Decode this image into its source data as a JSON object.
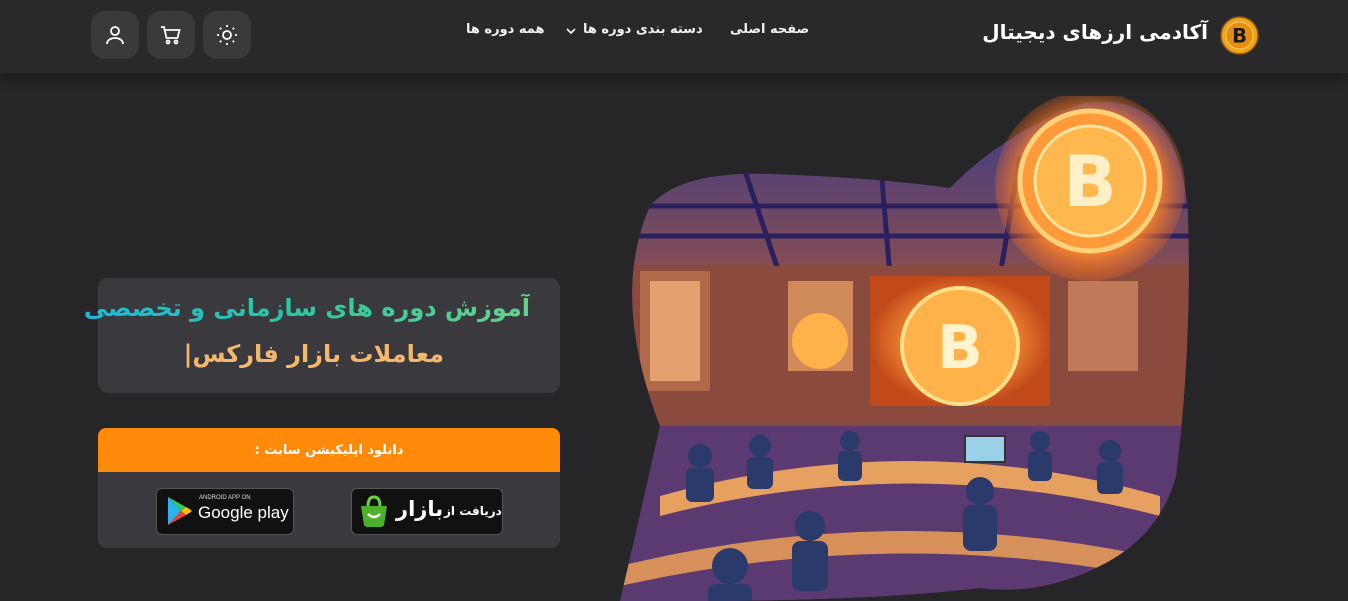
{
  "header": {
    "logo_text": "آکادمی ارزهای دیجیتال",
    "nav": {
      "home": "صفحه اصلی",
      "categories": "دسته بندی دوره ها",
      "all_courses": "همه دوره ها"
    },
    "icons": [
      "user-icon",
      "cart-icon",
      "sun-icon"
    ]
  },
  "hero": {
    "title_line1": "آموزش دوره های سازمانی و تخصصی",
    "title_line2": "معاملات بازار فارکس|"
  },
  "download": {
    "label": "دانلود اپلیکیشن سایت :",
    "bazaar_prefix": "دریافت از",
    "bazaar_name": "بازار",
    "google_small": "ANDROID APP ON",
    "google_name": "Google play"
  },
  "colors": {
    "accent_orange": "#ff8a0a",
    "title_gradient_start": "#1fb9d9",
    "title_gradient_end": "#62d48a",
    "title_line2": "#f5b76b",
    "background": "#262628"
  }
}
